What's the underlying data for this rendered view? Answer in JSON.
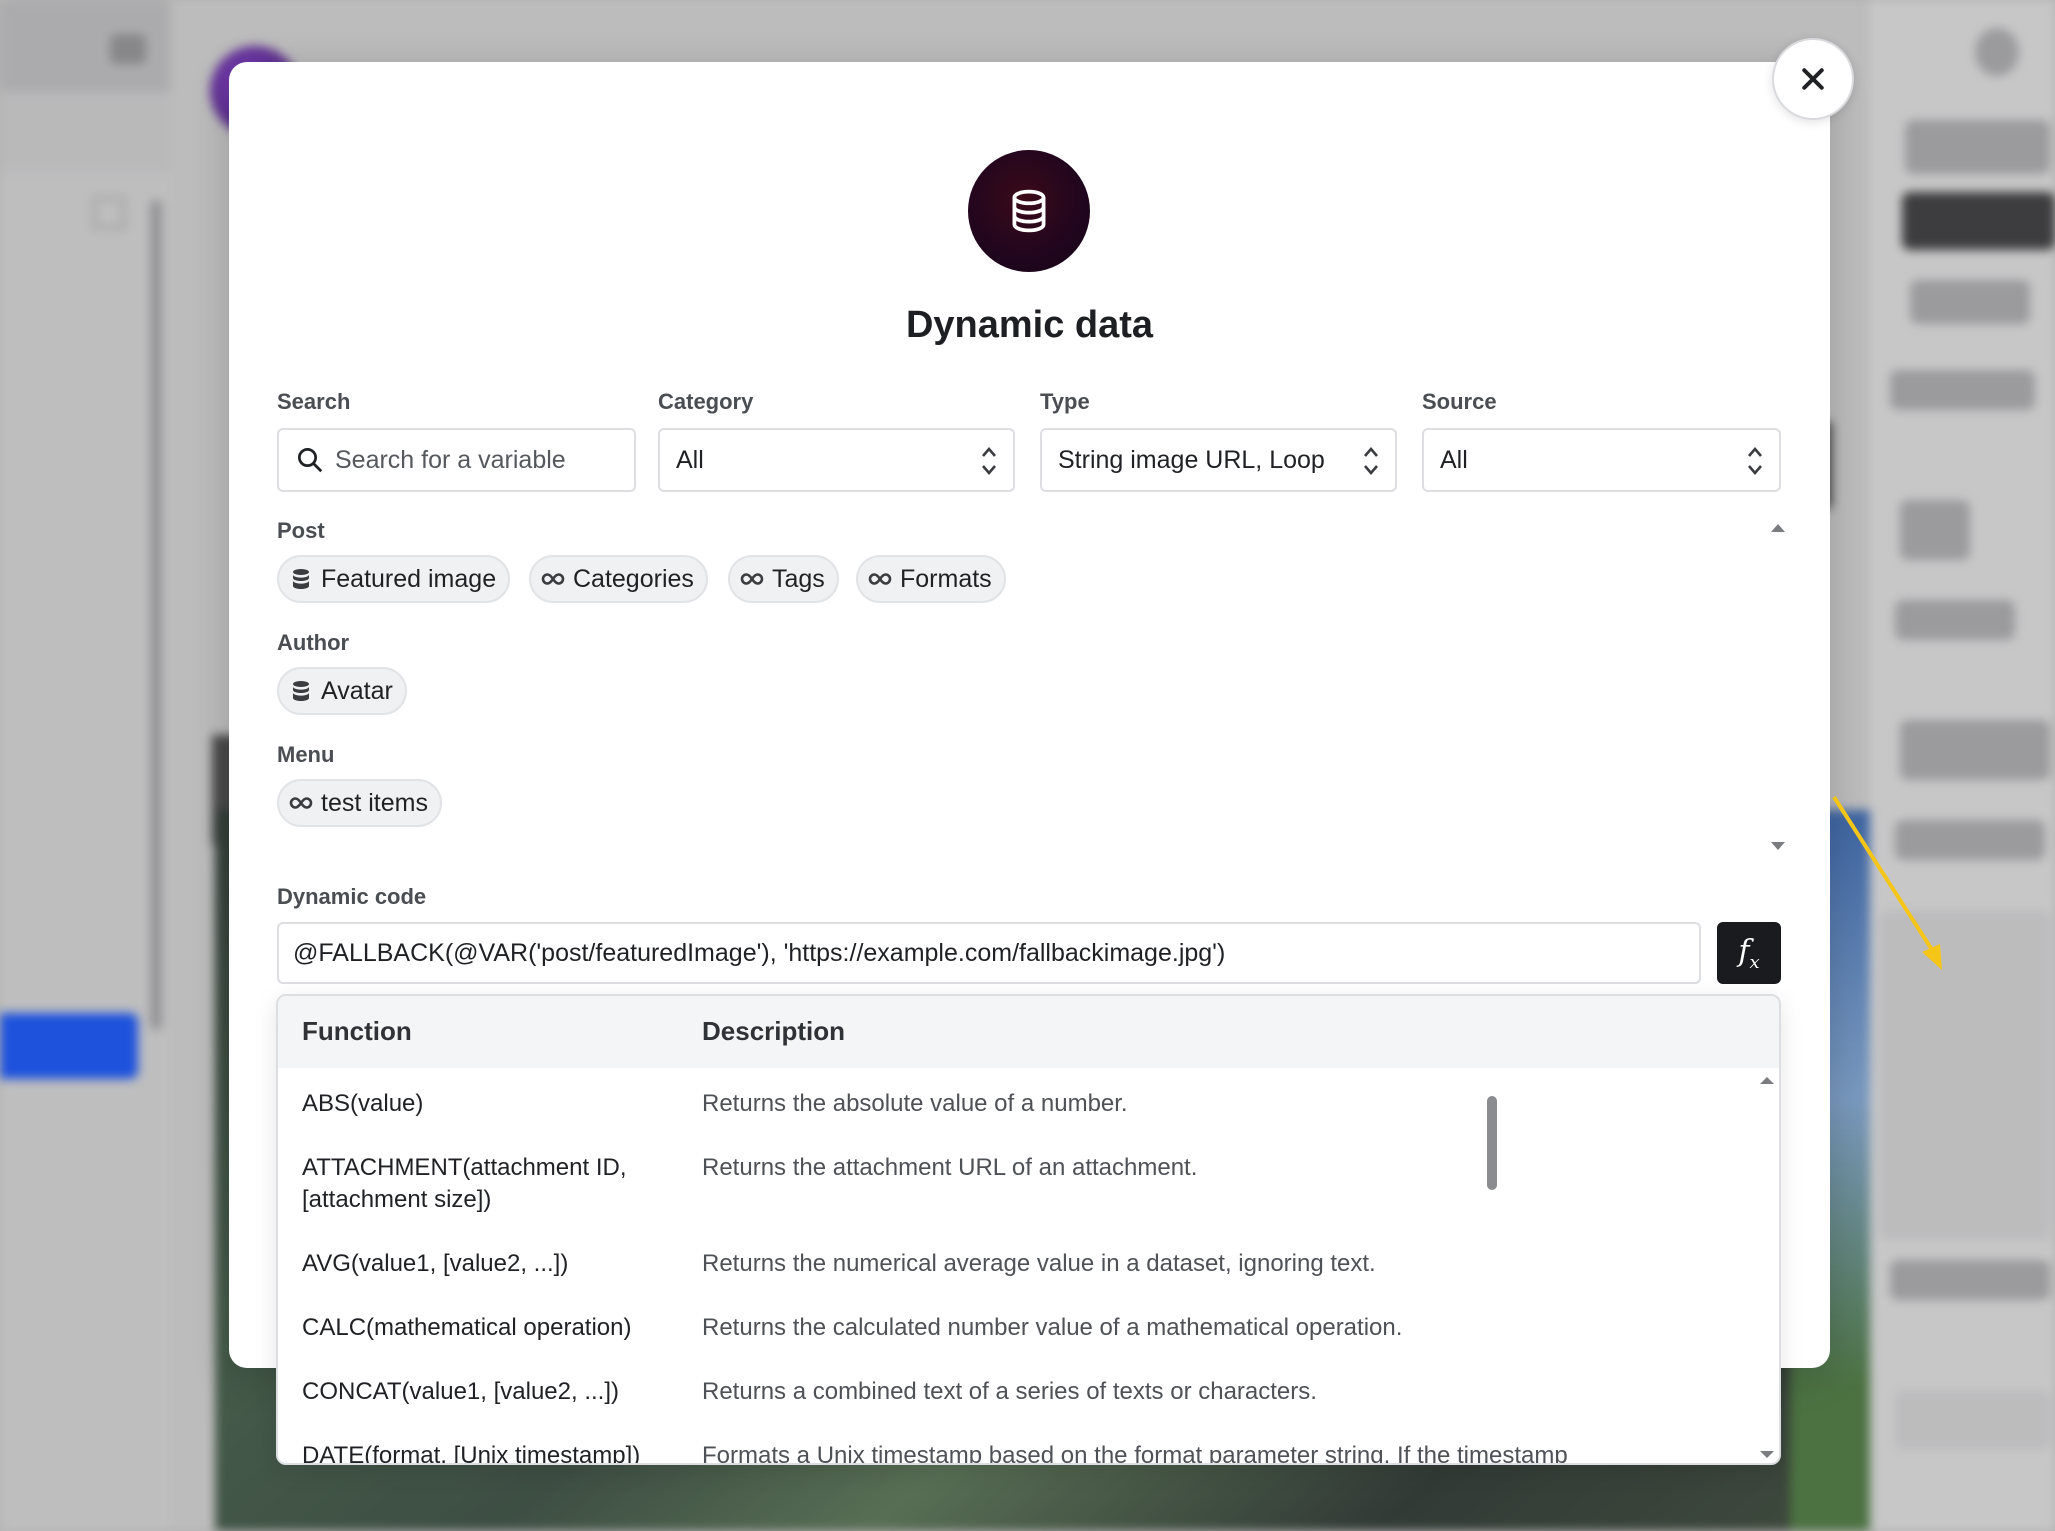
{
  "modal": {
    "title": "Dynamic data",
    "close_label": "close"
  },
  "filters": {
    "search": {
      "label": "Search",
      "placeholder": "Search for a variable"
    },
    "category": {
      "label": "Category",
      "value": "All"
    },
    "type": {
      "label": "Type",
      "value": "String image URL, Loop"
    },
    "source": {
      "label": "Source",
      "value": "All"
    }
  },
  "groups": [
    {
      "label": "Post",
      "items": [
        {
          "label": "Featured image",
          "icon": "database-icon"
        },
        {
          "label": "Categories",
          "icon": "loop-icon"
        },
        {
          "label": "Tags",
          "icon": "loop-icon"
        },
        {
          "label": "Formats",
          "icon": "loop-icon"
        }
      ]
    },
    {
      "label": "Author",
      "items": [
        {
          "label": "Avatar",
          "icon": "database-icon"
        }
      ]
    },
    {
      "label": "Menu",
      "items": [
        {
          "label": "test items",
          "icon": "loop-icon"
        }
      ]
    }
  ],
  "dynamic_code": {
    "label": "Dynamic code",
    "value": "@FALLBACK(@VAR('post/featuredImage'), 'https://example.com/fallbackimage.jpg')"
  },
  "functions": {
    "header": {
      "function": "Function",
      "description": "Description"
    },
    "rows": [
      {
        "name": "ABS(value)",
        "description": "Returns the absolute value of a number."
      },
      {
        "name": "ATTACHMENT(attachment ID, [attachment size])",
        "description": "Returns the attachment URL of an attachment."
      },
      {
        "name": "AVG(value1, [value2, ...])",
        "description": "Returns the numerical average value in a dataset, ignoring text."
      },
      {
        "name": "CALC(mathematical operation)",
        "description": "Returns the calculated number value of a mathematical operation."
      },
      {
        "name": "CONCAT(value1, [value2, ...])",
        "description": "Returns a combined text of a series of texts or characters."
      },
      {
        "name": "DATE(format, [Unix timestamp])",
        "description": "Formats a Unix timestamp based on the format parameter string. If the timestamp"
      }
    ]
  },
  "colors": {
    "accent_arrow": "#f5c518",
    "fx_button": "#1a1b1e",
    "hero_icon": "#22061e"
  }
}
